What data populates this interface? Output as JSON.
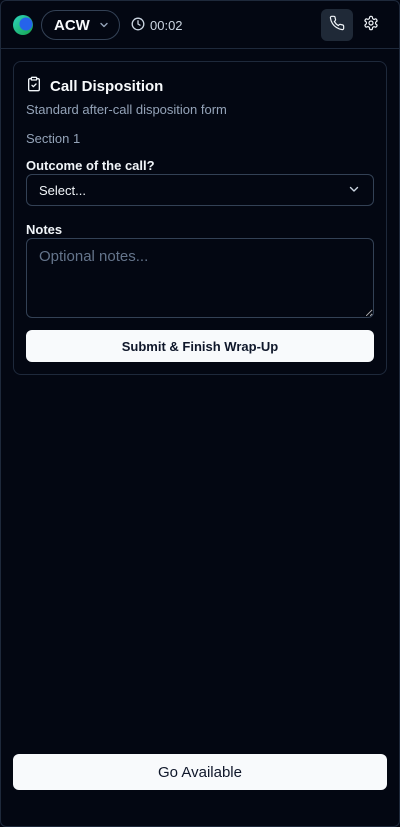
{
  "header": {
    "status_label": "ACW",
    "timer": "00:02",
    "icons": {
      "logo": "app-logo",
      "status_chevron": "chevron-down-icon",
      "timer": "clock-icon",
      "phone": "phone-icon",
      "settings": "gear-icon"
    }
  },
  "form": {
    "title": "Call Disposition",
    "subtitle": "Standard after-call disposition form",
    "section": "Section 1",
    "outcome_label": "Outcome of the call?",
    "outcome_value": "Select...",
    "notes_label": "Notes",
    "notes_placeholder": "Optional notes...",
    "notes_value": "",
    "submit_label": "Submit & Finish Wrap-Up",
    "title_icon": "clipboard-check-icon"
  },
  "footer": {
    "available_label": "Go Available"
  },
  "colors": {
    "background": "#030712",
    "border": "#1e293b",
    "logo_teal": "#14b8a6",
    "logo_blue": "#2563eb",
    "button_bg": "#f8fafc"
  }
}
